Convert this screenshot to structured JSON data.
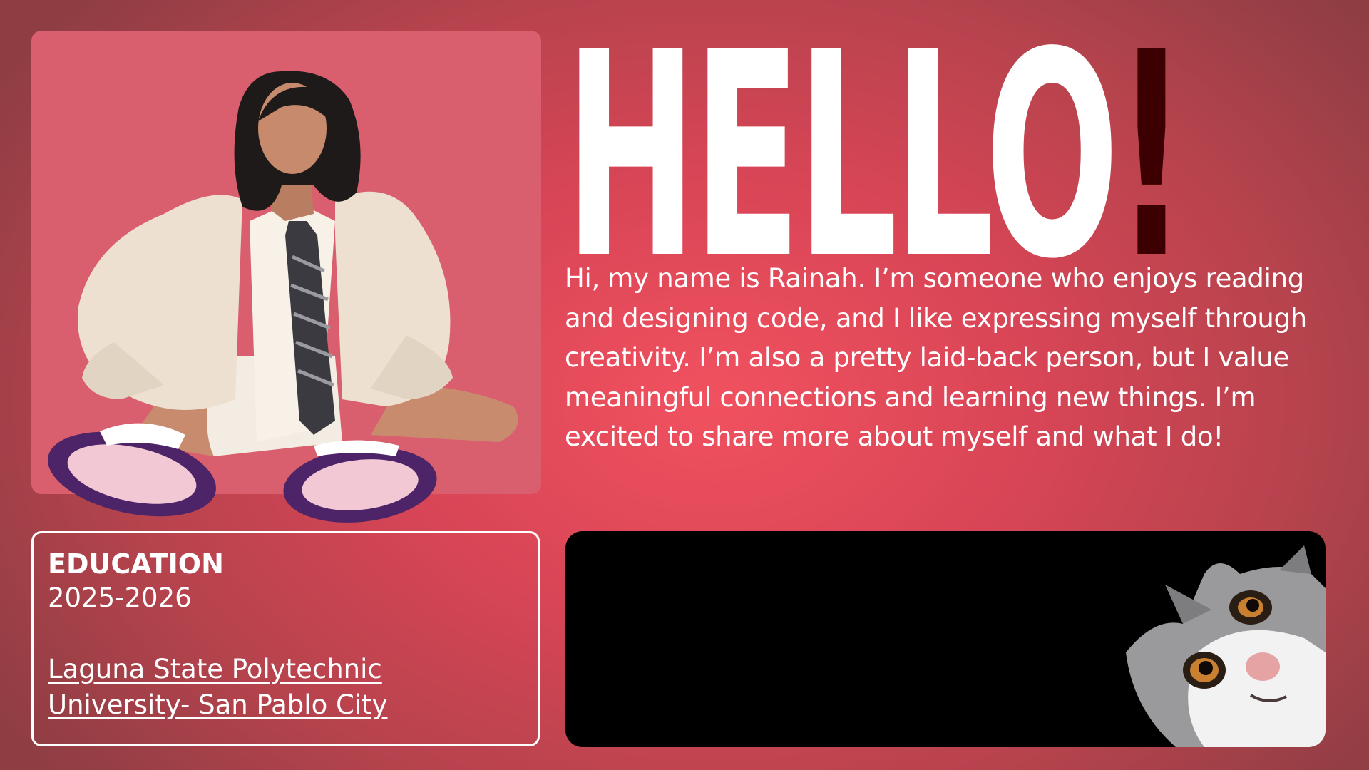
{
  "hero": {
    "title": "HELLO",
    "exclamation": "!"
  },
  "bio": {
    "text": "Hi, my name is Rainah. I’m someone who enjoys reading and designing code, and I like expressing myself through creativity. I’m also a pretty laid-back person, but I value meaningful connections and learning new things. I’m excited to share more about myself and what I do!"
  },
  "education": {
    "heading": "EDUCATION",
    "years": "2025-2026",
    "school": "Laguna State Polytechnic University- San Pablo City"
  },
  "colors": {
    "background_center": "#f1515f",
    "background_edge": "#8e3d43",
    "photo_card": "#d95f6e",
    "exclamation": "#3c0002",
    "text": "#ffffff",
    "video_panel": "#000000"
  },
  "icons": {
    "portrait": "portrait-photo",
    "cat": "cat-peeking-image"
  }
}
